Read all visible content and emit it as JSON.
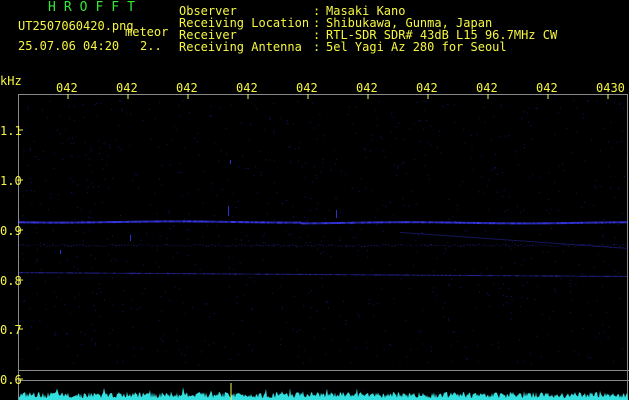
{
  "app": {
    "title": "HROFFT"
  },
  "file": {
    "name": "UT2507060420.png",
    "datetime": "25.07.06 04:20",
    "tag": "meteor",
    "count": "2.."
  },
  "header": [
    {
      "label": "Observer",
      "value": "Masaki Kano"
    },
    {
      "label": "Receiving Location",
      "value": "Shibukawa, Gunma, Japan"
    },
    {
      "label": "Receiver",
      "value": "RTL-SDR SDR# 43dB L15 96.7MHz CW"
    },
    {
      "label": "Receiving Antenna",
      "value": "5el Yagi Az 280 for Seoul"
    }
  ],
  "header_separator": ":",
  "axis": {
    "y_unit": "kHz",
    "y_ticks": [
      "1.1",
      "1.0",
      "0.9",
      "0.8",
      "0.7",
      "0.6"
    ],
    "x_ticks": [
      "042",
      "042",
      "042",
      "042",
      "042",
      "042",
      "042",
      "042",
      "042",
      "0430"
    ]
  },
  "colors": {
    "background": "#000000",
    "text": "#f7f742",
    "logo": "#37e637",
    "grid": "#8a8a8a",
    "signal": "#3b3bff",
    "spectrum": "#33e0e0"
  }
}
